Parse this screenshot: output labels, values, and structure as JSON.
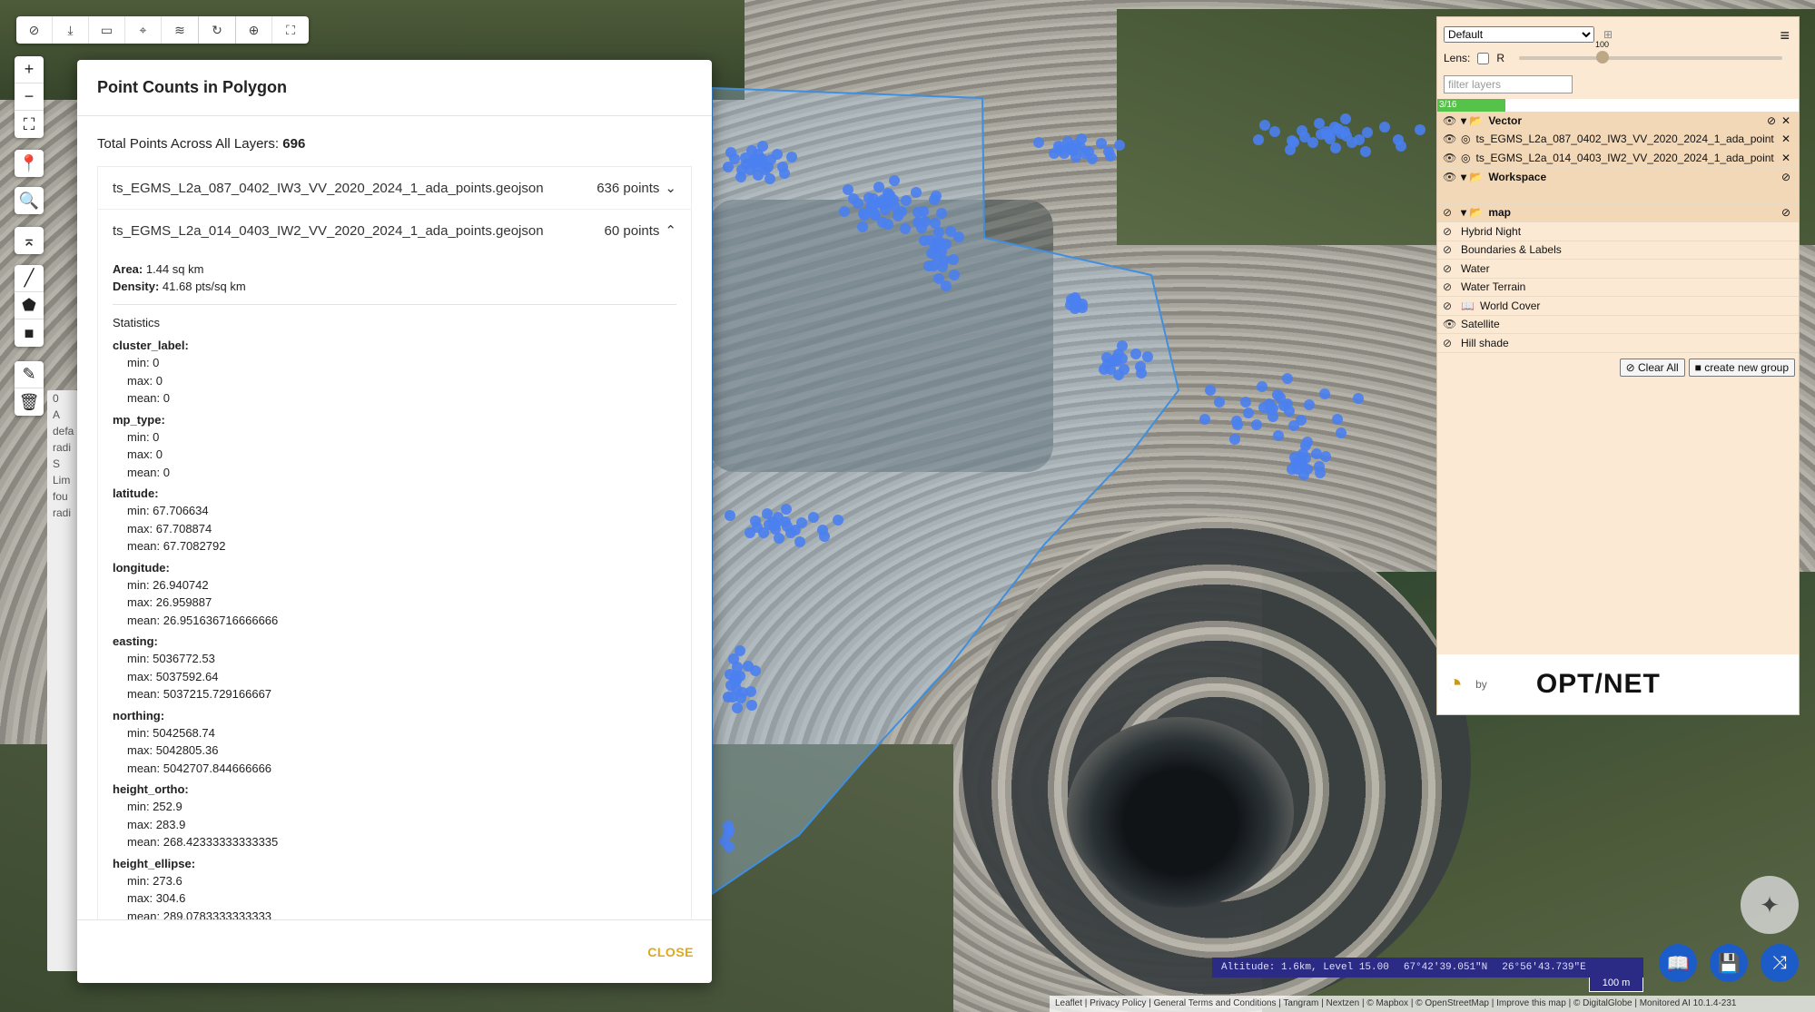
{
  "toolbar": {
    "icons": [
      "hide-icon",
      "download-icon",
      "camera-icon",
      "target-icon",
      "settings-icon",
      "reset-icon",
      "locate-icon",
      "crop-icon"
    ]
  },
  "modal": {
    "title": "Point Counts in Polygon",
    "total_label": "Total Points Across All Layers:",
    "total_value": "696",
    "layers": [
      {
        "name": "ts_EGMS_L2a_087_0402_IW3_VV_2020_2024_1_ada_points.geojson",
        "count": "636 points",
        "chevron": "⌄"
      },
      {
        "name": "ts_EGMS_L2a_014_0403_IW2_VV_2020_2024_1_ada_points.geojson",
        "count": "60 points",
        "chevron": "⌃"
      }
    ],
    "area_label": "Area:",
    "area_value": "1.44 sq km",
    "density_label": "Density:",
    "density_value": "41.68 pts/sq km",
    "statistics_label": "Statistics",
    "stats": [
      {
        "name": "cluster_label:",
        "min": "min: 0",
        "max": "max: 0",
        "mean": "mean: 0"
      },
      {
        "name": "mp_type:",
        "min": "min: 0",
        "max": "max: 0",
        "mean": "mean: 0"
      },
      {
        "name": "latitude:",
        "min": "min: 67.706634",
        "max": "max: 67.708874",
        "mean": "mean: 67.7082792"
      },
      {
        "name": "longitude:",
        "min": "min: 26.940742",
        "max": "max: 26.959887",
        "mean": "mean: 26.951636716666666"
      },
      {
        "name": "easting:",
        "min": "min: 5036772.53",
        "max": "max: 5037592.64",
        "mean": "mean: 5037215.729166667"
      },
      {
        "name": "northing:",
        "min": "min: 5042568.74",
        "max": "max: 5042805.36",
        "mean": "mean: 5042707.844666666"
      },
      {
        "name": "height_ortho:",
        "min": "min: 252.9",
        "max": "max: 283.9",
        "mean": "mean: 268.42333333333335"
      },
      {
        "name": "height_ellipse:",
        "min": "min: 273.6",
        "max": "max: 304.6",
        "mean": "mean: 289.0783333333333"
      }
    ],
    "close_label": "CLOSE"
  },
  "layer_panel": {
    "preset": "Default",
    "lens_label": "Lens:",
    "r_label": "R",
    "lens_value": "100",
    "filter_placeholder": "filter layers",
    "progress_text": "3/16",
    "progress_fraction": 0.1875,
    "rows": [
      {
        "label": "Vector",
        "type": "folder",
        "bold": true
      },
      {
        "label": "ts_EGMS_L2a_087_0402_IW3_VV_2020_2024_1_ada_point",
        "type": "layer"
      },
      {
        "label": "ts_EGMS_L2a_014_0403_IW2_VV_2020_2024_1_ada_point",
        "type": "layer"
      },
      {
        "label": "Workspace",
        "type": "folder",
        "bold": true
      },
      {
        "label": "map",
        "type": "folder",
        "bold": true
      },
      {
        "label": "Hybrid Night",
        "type": "base"
      },
      {
        "label": "Boundaries & Labels",
        "type": "base"
      },
      {
        "label": "Water",
        "type": "base"
      },
      {
        "label": "Water Terrain",
        "type": "base"
      },
      {
        "label": "World Cover",
        "type": "base"
      },
      {
        "label": "Satellite",
        "type": "base"
      },
      {
        "label": "Hill shade",
        "type": "base"
      }
    ],
    "clear_all": "Clear All",
    "create_group": "create new group",
    "by_label": "by",
    "brand": "OPT/NET"
  },
  "bg_panel": {
    "labels": [
      "0",
      "A",
      "defa",
      "radi",
      "S",
      "Lim",
      "fou",
      "radi"
    ]
  },
  "status": {
    "altitude": "Altitude: 1.6km, Level 15.00",
    "lat": "67°42'39.051\"N",
    "lon": "26°56'43.739\"E",
    "scale": "100 m",
    "attribution": "Leaflet | Privacy Policy | General Terms and Conditions | Tangram | Nextzen | © Mapbox | © OpenStreetMap | Improve this map | © DigitalGlobe | Monitored AI 10.1.4-231"
  }
}
